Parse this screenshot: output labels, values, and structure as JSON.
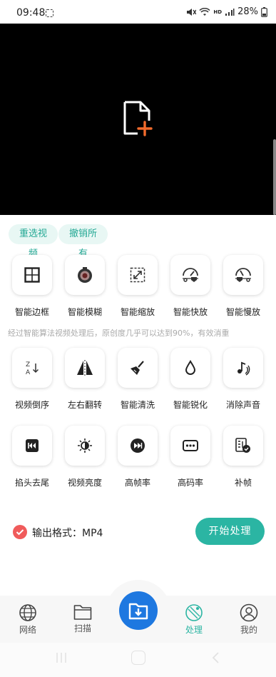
{
  "status_bar": {
    "time": "09:48",
    "network": "HD",
    "battery": "28%"
  },
  "video": {
    "placeholder_icon": "add-file-icon"
  },
  "actions": {
    "reselect_label": "重选视频",
    "undo_all_label": "撤销所有"
  },
  "tools_row1": [
    {
      "label": "智能边框",
      "icon": "border-grid-icon"
    },
    {
      "label": "智能模糊",
      "icon": "blur-lens-icon"
    },
    {
      "label": "智能缩放",
      "icon": "scale-arrows-icon"
    },
    {
      "label": "智能快放",
      "icon": "fast-speed-icon"
    },
    {
      "label": "智能慢放",
      "icon": "slow-speed-icon"
    }
  ],
  "hint": "经过智能算法视频处理后，原创度几乎可以达到90%，有效消重",
  "tools_row2": [
    {
      "label": "视频倒序",
      "icon": "reverse-sort-icon"
    },
    {
      "label": "左右翻转",
      "icon": "flip-horizontal-icon"
    },
    {
      "label": "智能清洗",
      "icon": "broom-icon"
    },
    {
      "label": "智能锐化",
      "icon": "sharpen-drop-icon"
    },
    {
      "label": "消除声音",
      "icon": "mute-note-icon"
    }
  ],
  "tools_row3": [
    {
      "label": "掐头去尾",
      "icon": "skip-back-icon"
    },
    {
      "label": "视频亮度",
      "icon": "brightness-icon"
    },
    {
      "label": "高帧率",
      "icon": "fast-forward-icon"
    },
    {
      "label": "高码率",
      "icon": "bitrate-dots-icon"
    },
    {
      "label": "补帧",
      "icon": "frame-fill-icon"
    }
  ],
  "output": {
    "format_label": "输出格式：MP4",
    "start_label": "开始处理"
  },
  "nav": {
    "items": [
      {
        "label": "网络",
        "icon": "globe-icon"
      },
      {
        "label": "扫描",
        "icon": "folder-icon"
      },
      {
        "label": "处理",
        "icon": "process-satellite-icon",
        "active": true
      },
      {
        "label": "我的",
        "icon": "user-icon"
      }
    ],
    "center_icon": "download-folder-icon"
  },
  "colors": {
    "accent": "#2bb5a3",
    "pill_bg": "#e8f7f4",
    "check_red": "#f05b5b",
    "center_blue": "#1e78e0"
  }
}
